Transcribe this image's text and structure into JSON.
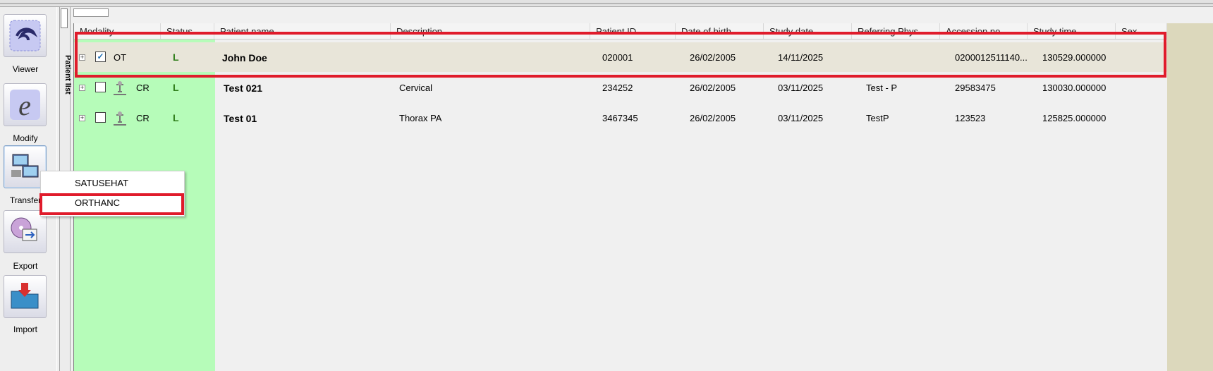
{
  "toolbar": {
    "tools": [
      {
        "label": "Viewer",
        "icon": "viewer-icon"
      },
      {
        "label": "Modify",
        "icon": "modify-e-icon"
      },
      {
        "label": "Transfer",
        "icon": "network-transfer-icon"
      },
      {
        "label": "Export",
        "icon": "export-cd-icon"
      },
      {
        "label": "Import",
        "icon": "import-folder-icon"
      }
    ]
  },
  "sidepanel": {
    "label": "Patient list"
  },
  "table": {
    "headers": [
      "Modality",
      "Status",
      "Patient name",
      "Description",
      "Patient ID",
      "Date of birth",
      "Study date",
      "Referring Phys.",
      "Accession no.",
      "Study time",
      "Sex"
    ],
    "rows": [
      {
        "checked": true,
        "modality": "OT",
        "patient_name": "John Doe",
        "description": "",
        "patient_id": "020001",
        "dob": "26/02/2005",
        "study_date": "14/11/2025",
        "referring": "",
        "accession": "0200012511140...",
        "study_time": "130529.000000",
        "sex": ""
      },
      {
        "checked": false,
        "modality": "CR",
        "patient_name": "Test 021",
        "description": "Cervical",
        "patient_id": "234252",
        "dob": "26/02/2005",
        "study_date": "03/11/2025",
        "referring": "Test - P",
        "accession": "29583475",
        "study_time": "130030.000000",
        "sex": ""
      },
      {
        "checked": false,
        "modality": "CR",
        "patient_name": "Test 01",
        "description": "Thorax PA",
        "patient_id": "3467345",
        "dob": "26/02/2005",
        "study_date": "03/11/2025",
        "referring": "TestP",
        "accession": "123523",
        "study_time": "125825.000000",
        "sex": ""
      }
    ]
  },
  "context_menu": {
    "items": [
      "SATUSEHAT",
      "ORTHANC"
    ]
  },
  "colors": {
    "highlight": "#e01b2b",
    "green_column": "#b6fcb9",
    "selected_row": "#e8e5d9"
  }
}
